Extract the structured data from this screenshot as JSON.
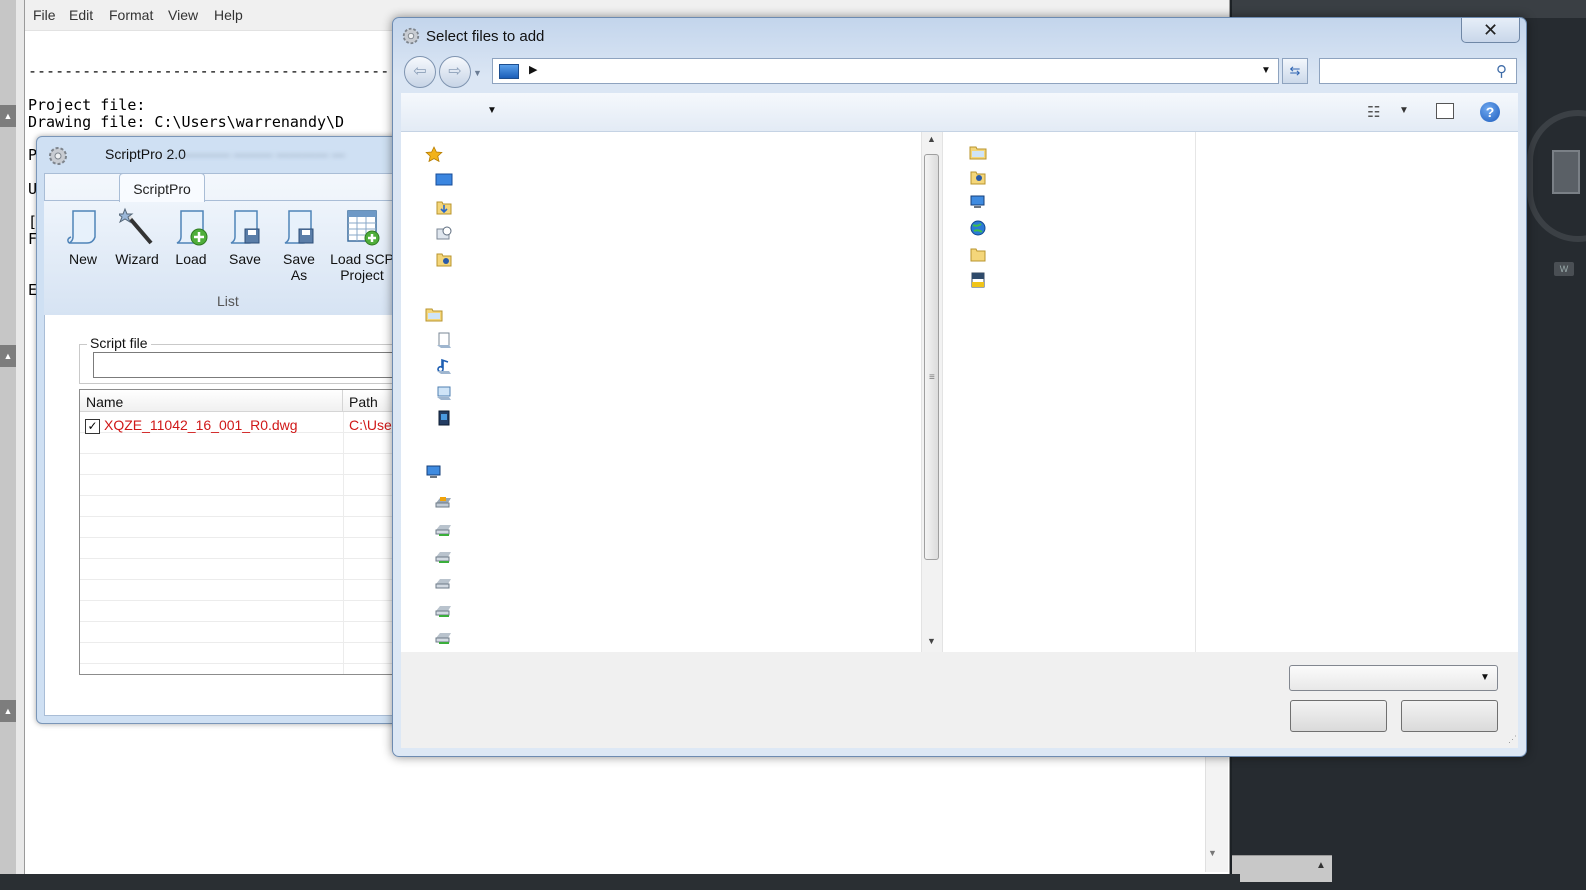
{
  "notepad": {
    "menu": [
      "File",
      "Edit",
      "Format",
      "View",
      "Help"
    ],
    "dashes": "----------------------------------------",
    "project_label": "Project file:",
    "drawing_line": "Drawing file:   C:\\Users\\warrenandy\\D",
    "fragments": [
      "P",
      "U",
      "[",
      "F",
      "E"
    ]
  },
  "scriptpro": {
    "title": "ScriptPro 2.0",
    "tab": "ScriptPro",
    "buttons": {
      "new": "New",
      "wizard": "Wizard",
      "load": "Load",
      "save": "Save",
      "save_as_1": "Save",
      "save_as_2": "As",
      "load_scp_1": "Load SCP",
      "load_scp_2": "Project"
    },
    "group_label": "List",
    "script_file_label": "Script file",
    "columns": {
      "name": "Name",
      "path": "Path"
    },
    "files": [
      {
        "checked": true,
        "name": "XQZE_11042_16_001_R0.dwg",
        "path": "C:\\Use"
      }
    ]
  },
  "dialog": {
    "title": "Select files to add",
    "close_glyph": "✕",
    "help_glyph": "?"
  },
  "colors": {
    "accent_blue": "#1d5cbd",
    "file_text_red": "#d01818",
    "ribbon_bg": "#dde8f5"
  }
}
